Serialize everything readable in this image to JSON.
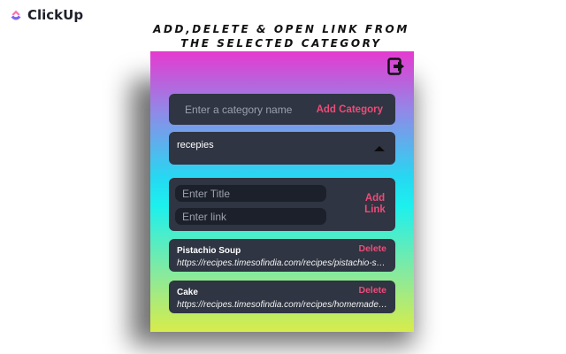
{
  "brand": {
    "name": "ClickUp",
    "icon": "clickup-logo-icon"
  },
  "headline": {
    "line1": "ADD,DELETE & OPEN LINK FROM",
    "line2": "THE SELECTED CATEGORY"
  },
  "popup": {
    "logout_icon": "logout-icon",
    "category": {
      "placeholder": "Enter a category name",
      "add_label": "Add Category"
    },
    "selector": {
      "selected": "recepies",
      "caret_icon": "caret-up-icon"
    },
    "link_form": {
      "title_placeholder": "Enter Title",
      "link_placeholder": "Enter link",
      "add_label_line1": "Add",
      "add_label_line2": "Link"
    },
    "links": [
      {
        "title": "Pistachio Soup",
        "url": "https://recipes.timesofindia.com/recipes/pistachio-soup",
        "delete_label": "Delete"
      },
      {
        "title": "Cake",
        "url": "https://recipes.timesofindia.com/recipes/homemade-cake",
        "delete_label": "Delete"
      }
    ]
  },
  "colors": {
    "accent": "#ef4b78",
    "card": "#2f3542",
    "gradient_top": "#e53ad0",
    "gradient_mid": "#1cf0ee",
    "gradient_bottom": "#d8ec4a"
  }
}
